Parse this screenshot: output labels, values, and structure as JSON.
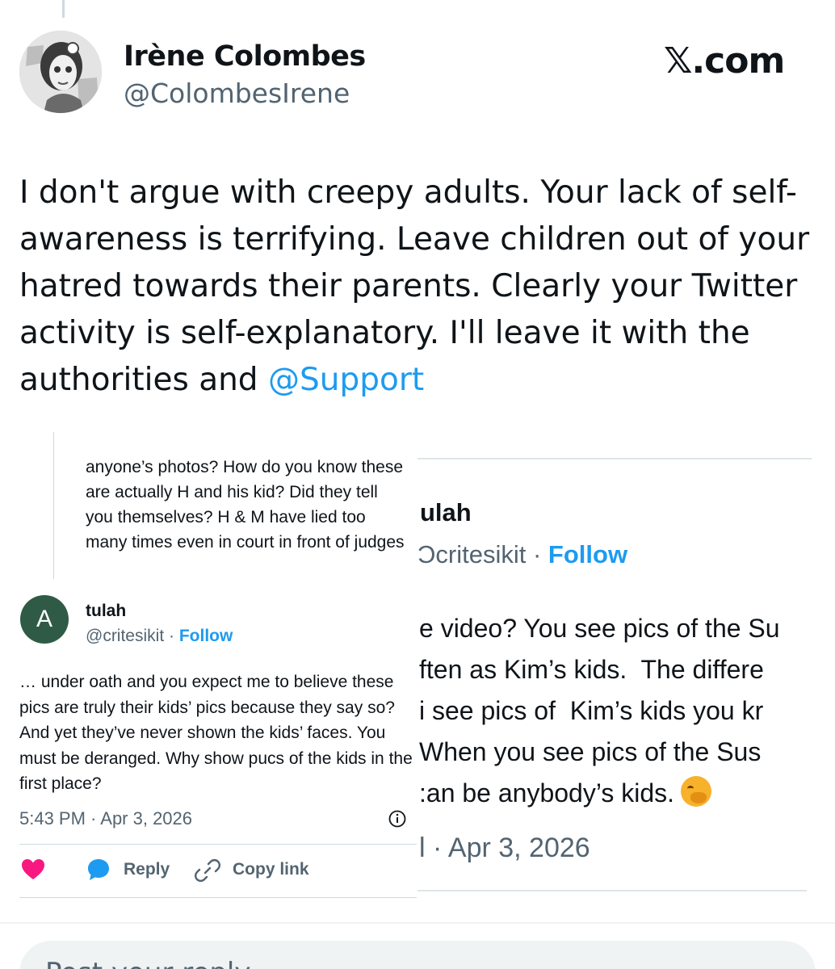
{
  "post": {
    "display_name": "Irène Colombes",
    "handle": "@ColombesIrene",
    "brand": "𝕏.com",
    "text_before_mention": "I don't argue with creepy adults. Your lack of self-awareness is terrifying. Leave children out of your hatred towards their parents. Clearly your Twitter activity is self-explanatory. I'll leave it with the authorities and ",
    "mention": "@Support",
    "reply_placeholder": "Post your reply"
  },
  "left_screenshot": {
    "quoted_text": "anyone’s photos? How do you know these are actually H and his kid? Did they tell you themselves?  H & M have lied too many times even in court in front of judges",
    "avatar_letter": "A",
    "name": "tulah",
    "handle": "@critesikit",
    "separator": " · ",
    "follow": "Follow",
    "body": "… under oath and you expect me to believe these pics are truly their kids’ pics because they say so?  And yet they’ve never shown the kids’ faces. You must be deranged.  Why show pucs of the kids in the first place?",
    "timestamp": "5:43 PM · Apr 3, 2026",
    "reply_label": "Reply",
    "copy_link_label": "Copy link",
    "icons": [
      "info-icon",
      "heart-icon",
      "reply-bubble-icon",
      "link-icon"
    ]
  },
  "right_screenshot": {
    "name": "ulah",
    "handle": "Ͻcritesikit",
    "separator": " · ",
    "follow": "Follow",
    "lines": [
      "e video? You see pics of the Su",
      "ften as Kim’s kids.  The differe",
      "i see pics of  Kim’s kids you kr",
      "When you see pics of the Sus",
      ":an be anybody’s kids."
    ],
    "timestamp": "l · Apr 3, 2026"
  },
  "colors": {
    "link_blue": "#1d9bf0",
    "secondary_text": "#536471",
    "avatar_green": "#2f5b46",
    "like_pink": "#f91880"
  }
}
